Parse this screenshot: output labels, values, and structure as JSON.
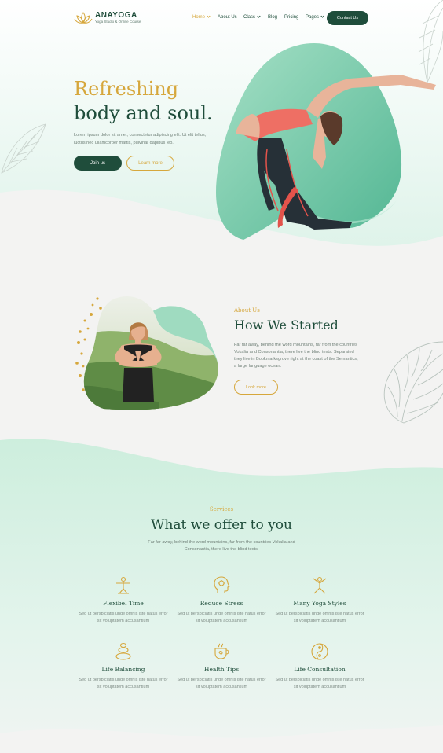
{
  "header": {
    "logo_name": "ANAYOGA",
    "logo_tagline": "Yoga Studio & Online Course",
    "nav": [
      {
        "label": "Home",
        "dropdown": true,
        "active": true
      },
      {
        "label": "About Us",
        "dropdown": false
      },
      {
        "label": "Class",
        "dropdown": true
      },
      {
        "label": "Blog",
        "dropdown": false
      },
      {
        "label": "Pricing",
        "dropdown": false
      },
      {
        "label": "Pages",
        "dropdown": true
      }
    ],
    "contact_label": "Contact Us"
  },
  "hero": {
    "title_line1": "Refreshing",
    "title_line2": "body and soul.",
    "text": "Lorem ipsum dolor sit amet, consectetur adipiscing elit. Ut elit tellus, luctus nec ullamcorper mattis, pulvinar dapibus leo.",
    "join_label": "Join us",
    "learn_label": "Learn more"
  },
  "about": {
    "kicker": "About Us",
    "title": "How We Started",
    "text": "Far far away, behind the word mountains, far from the countries Vokalia and Consonantia, there live the blind texts. Separated they live in Bookmarksgrove right at the coast of the Semantics, a large language ocean.",
    "button_label": "Look more"
  },
  "services": {
    "kicker": "Services",
    "title": "What we offer to you",
    "text": "Far far away, behind the word mountains, far from the countries Vokalia and Consonantia, there live the blind texts.",
    "items": [
      {
        "icon": "yoga-pose-icon",
        "title": "Flexibel Time",
        "desc": "Sed ut perspiciatis unde omnis iste natus error sit voluptatem accusantium"
      },
      {
        "icon": "head-mind-icon",
        "title": "Reduce Stress",
        "desc": "Sed ut perspiciatis unde omnis iste natus error sit voluptatem accusantium"
      },
      {
        "icon": "yoga-styles-icon",
        "title": "Many Yoga Styles",
        "desc": "Sed ut perspiciatis unde omnis iste natus error sit voluptatem accusantium"
      },
      {
        "icon": "balance-stones-icon",
        "title": "Life Balancing",
        "desc": "Sed ut perspiciatis unde omnis iste natus error sit voluptatem accusantium"
      },
      {
        "icon": "tea-cup-icon",
        "title": "Health Tips",
        "desc": "Sed ut perspiciatis unde omnis iste natus error sit voluptatem accusantium"
      },
      {
        "icon": "yin-yang-icon",
        "title": "Life Consultation",
        "desc": "Sed ut perspiciatis unde omnis iste natus error sit voluptatem accusantium"
      }
    ]
  },
  "colors": {
    "primary": "#1f4d3b",
    "accent": "#d6a73c",
    "mint": "#9fdbc0",
    "background": "#f3f3f2"
  }
}
